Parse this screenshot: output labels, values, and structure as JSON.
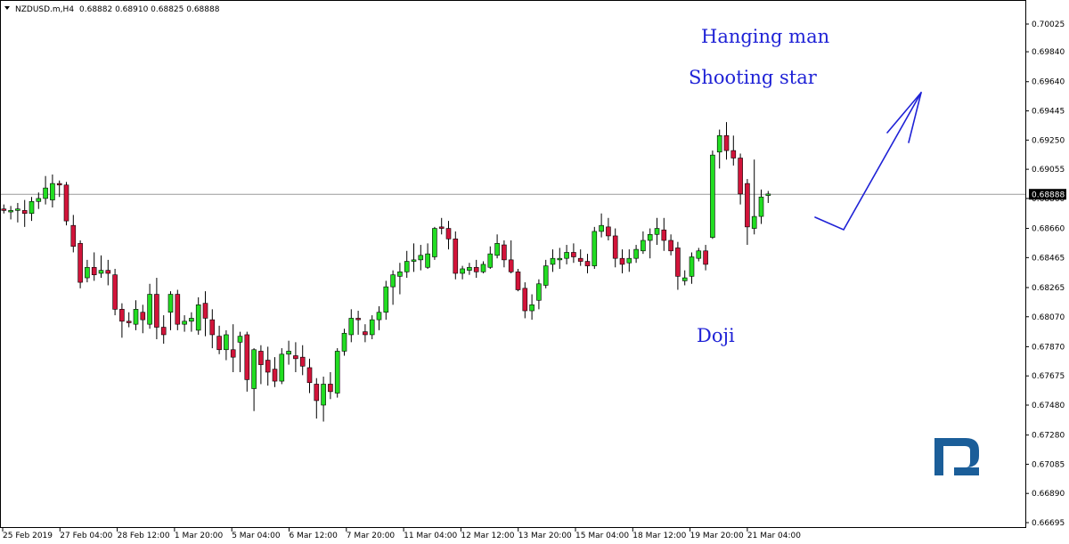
{
  "header": {
    "symbol": "NZDUSD.m,H4",
    "ohlc": "0.68882 0.68910 0.68825 0.68888"
  },
  "current_price_label": "0.68888",
  "colors": {
    "bull": "#22dd22",
    "bear": "#d2143a",
    "wick": "#000000",
    "annotation": "#1f22d6",
    "logo": "#1b5e99"
  },
  "annotations": [
    "Hanging man",
    "Shooting star",
    "Doji"
  ],
  "chart_data": {
    "type": "candlestick",
    "title": "",
    "ylim": [
      0.66695,
      0.70025
    ],
    "y_ticks": [
      0.70025,
      0.6984,
      0.6964,
      0.69445,
      0.6925,
      0.69055,
      0.6886,
      0.6866,
      0.68465,
      0.68265,
      0.6807,
      0.6787,
      0.67675,
      0.6748,
      0.6728,
      0.67085,
      0.6689,
      0.66695
    ],
    "y_tick_labels": [
      "0.70025",
      "0.69840",
      "0.69640",
      "0.69445",
      "0.69250",
      "0.69055",
      "0.68860",
      "0.68660",
      "0.68465",
      "0.68265",
      "0.68070",
      "0.67870",
      "0.67675",
      "0.67480",
      "0.67280",
      "0.67085",
      "0.66890",
      "0.66695"
    ],
    "x_tick_labels": [
      "25 Feb 2019",
      "27 Feb 04:00",
      "28 Feb 12:00",
      "1 Mar 20:00",
      "5 Mar 04:00",
      "6 Mar 12:00",
      "7 Mar 20:00",
      "11 Mar 04:00",
      "12 Mar 12:00",
      "13 Mar 20:00",
      "15 Mar 04:00",
      "18 Mar 12:00",
      "19 Mar 20:00",
      "21 Mar 04:00"
    ],
    "current_price": 0.68888,
    "candles": [
      [
        0.6879,
        0.6882,
        0.6876,
        0.6878
      ],
      [
        0.6877,
        0.6881,
        0.6872,
        0.6878
      ],
      [
        0.6878,
        0.6883,
        0.687,
        0.6879
      ],
      [
        0.6878,
        0.6885,
        0.6867,
        0.6876
      ],
      [
        0.6876,
        0.6887,
        0.6871,
        0.6884
      ],
      [
        0.6884,
        0.689,
        0.6879,
        0.6886
      ],
      [
        0.6886,
        0.6901,
        0.6882,
        0.6893
      ],
      [
        0.6885,
        0.6902,
        0.688,
        0.6896
      ],
      [
        0.6896,
        0.6898,
        0.6887,
        0.6895
      ],
      [
        0.6895,
        0.6897,
        0.6868,
        0.6871
      ],
      [
        0.6868,
        0.6875,
        0.685,
        0.6854
      ],
      [
        0.6856,
        0.6858,
        0.6826,
        0.683
      ],
      [
        0.6833,
        0.6845,
        0.683,
        0.684
      ],
      [
        0.684,
        0.685,
        0.6831,
        0.6835
      ],
      [
        0.6836,
        0.6848,
        0.6833,
        0.6838
      ],
      [
        0.6838,
        0.6845,
        0.6828,
        0.6836
      ],
      [
        0.6835,
        0.6839,
        0.6808,
        0.6812
      ],
      [
        0.6812,
        0.6816,
        0.6793,
        0.6804
      ],
      [
        0.6804,
        0.681,
        0.68,
        0.6803
      ],
      [
        0.6802,
        0.6818,
        0.6798,
        0.6812
      ],
      [
        0.681,
        0.6815,
        0.6796,
        0.6805
      ],
      [
        0.6802,
        0.6829,
        0.6799,
        0.6822
      ],
      [
        0.6822,
        0.6833,
        0.6792,
        0.68
      ],
      [
        0.68,
        0.6808,
        0.6789,
        0.6795
      ],
      [
        0.681,
        0.6824,
        0.6798,
        0.6822
      ],
      [
        0.6822,
        0.6825,
        0.6798,
        0.6802
      ],
      [
        0.6802,
        0.6808,
        0.6797,
        0.6804
      ],
      [
        0.6804,
        0.681,
        0.6797,
        0.6806
      ],
      [
        0.6798,
        0.682,
        0.6795,
        0.6815
      ],
      [
        0.6816,
        0.6824,
        0.6794,
        0.6806
      ],
      [
        0.6805,
        0.6812,
        0.6786,
        0.6795
      ],
      [
        0.6794,
        0.6801,
        0.6782,
        0.6785
      ],
      [
        0.6785,
        0.6798,
        0.6778,
        0.6795
      ],
      [
        0.6785,
        0.6802,
        0.677,
        0.678
      ],
      [
        0.679,
        0.6797,
        0.677,
        0.6794
      ],
      [
        0.6795,
        0.6797,
        0.6757,
        0.6765
      ],
      [
        0.6759,
        0.6786,
        0.6744,
        0.6785
      ],
      [
        0.6784,
        0.6788,
        0.6762,
        0.6775
      ],
      [
        0.6778,
        0.6787,
        0.6761,
        0.677
      ],
      [
        0.6772,
        0.678,
        0.676,
        0.6764
      ],
      [
        0.6764,
        0.6786,
        0.6762,
        0.6782
      ],
      [
        0.6782,
        0.6791,
        0.6775,
        0.6784
      ],
      [
        0.6781,
        0.679,
        0.677,
        0.6779
      ],
      [
        0.678,
        0.6788,
        0.6768,
        0.6774
      ],
      [
        0.6773,
        0.6779,
        0.6756,
        0.6763
      ],
      [
        0.6762,
        0.6766,
        0.6739,
        0.6751
      ],
      [
        0.6748,
        0.6767,
        0.6737,
        0.6762
      ],
      [
        0.6762,
        0.677,
        0.6752,
        0.6757
      ],
      [
        0.6756,
        0.6786,
        0.6753,
        0.6784
      ],
      [
        0.6784,
        0.6799,
        0.6781,
        0.6796
      ],
      [
        0.6795,
        0.6812,
        0.679,
        0.6806
      ],
      [
        0.6806,
        0.6811,
        0.6795,
        0.6805
      ],
      [
        0.6797,
        0.6802,
        0.679,
        0.6795
      ],
      [
        0.6795,
        0.6808,
        0.6792,
        0.6805
      ],
      [
        0.6805,
        0.6814,
        0.6798,
        0.681
      ],
      [
        0.681,
        0.6831,
        0.6805,
        0.6827
      ],
      [
        0.6827,
        0.6838,
        0.6815,
        0.6835
      ],
      [
        0.6834,
        0.6843,
        0.6822,
        0.6837
      ],
      [
        0.6837,
        0.6851,
        0.6833,
        0.6844
      ],
      [
        0.6844,
        0.6856,
        0.6837,
        0.6845
      ],
      [
        0.6845,
        0.6855,
        0.6838,
        0.6848
      ],
      [
        0.684,
        0.6856,
        0.6839,
        0.6849
      ],
      [
        0.6847,
        0.6867,
        0.6845,
        0.6866
      ],
      [
        0.6867,
        0.6873,
        0.6862,
        0.6866
      ],
      [
        0.6866,
        0.6871,
        0.6852,
        0.6859
      ],
      [
        0.6859,
        0.6864,
        0.6832,
        0.6836
      ],
      [
        0.6836,
        0.6841,
        0.6832,
        0.6839
      ],
      [
        0.6838,
        0.6843,
        0.6835,
        0.684
      ],
      [
        0.684,
        0.6845,
        0.6833,
        0.6837
      ],
      [
        0.6837,
        0.6844,
        0.6836,
        0.6842
      ],
      [
        0.684,
        0.6854,
        0.6839,
        0.6849
      ],
      [
        0.6848,
        0.6862,
        0.6846,
        0.6856
      ],
      [
        0.6855,
        0.6858,
        0.684,
        0.6845
      ],
      [
        0.6845,
        0.6858,
        0.6836,
        0.6837
      ],
      [
        0.6837,
        0.6839,
        0.6824,
        0.6825
      ],
      [
        0.6826,
        0.683,
        0.6806,
        0.6811
      ],
      [
        0.6811,
        0.6822,
        0.6805,
        0.6815
      ],
      [
        0.6818,
        0.6832,
        0.6812,
        0.6829
      ],
      [
        0.6828,
        0.6845,
        0.6826,
        0.6841
      ],
      [
        0.6842,
        0.6852,
        0.6837,
        0.6846
      ],
      [
        0.6845,
        0.6853,
        0.6839,
        0.6846
      ],
      [
        0.6846,
        0.6855,
        0.6842,
        0.685
      ],
      [
        0.685,
        0.6856,
        0.6843,
        0.6847
      ],
      [
        0.6846,
        0.6852,
        0.6841,
        0.6844
      ],
      [
        0.6844,
        0.6849,
        0.6836,
        0.6841
      ],
      [
        0.6841,
        0.6867,
        0.6839,
        0.6864
      ],
      [
        0.6864,
        0.6876,
        0.686,
        0.6868
      ],
      [
        0.6867,
        0.6873,
        0.6858,
        0.6861
      ],
      [
        0.6861,
        0.6866,
        0.684,
        0.6846
      ],
      [
        0.6846,
        0.6852,
        0.6836,
        0.6842
      ],
      [
        0.6843,
        0.6852,
        0.6837,
        0.6846
      ],
      [
        0.6846,
        0.6855,
        0.6843,
        0.6852
      ],
      [
        0.6851,
        0.6864,
        0.6849,
        0.6858
      ],
      [
        0.6858,
        0.6866,
        0.6846,
        0.6862
      ],
      [
        0.6862,
        0.6873,
        0.6855,
        0.6866
      ],
      [
        0.6865,
        0.6873,
        0.6851,
        0.6858
      ],
      [
        0.6858,
        0.6862,
        0.6848,
        0.6851
      ],
      [
        0.6853,
        0.6857,
        0.6825,
        0.6834
      ],
      [
        0.6831,
        0.6838,
        0.6828,
        0.6833
      ],
      [
        0.6834,
        0.685,
        0.6829,
        0.6847
      ],
      [
        0.6846,
        0.6853,
        0.6844,
        0.6851
      ],
      [
        0.6851,
        0.6855,
        0.6838,
        0.6842
      ],
      [
        0.686,
        0.6918,
        0.6859,
        0.6915
      ],
      [
        0.6917,
        0.6932,
        0.6906,
        0.6928
      ],
      [
        0.6928,
        0.6937,
        0.6912,
        0.6918
      ],
      [
        0.6918,
        0.6928,
        0.6908,
        0.6913
      ],
      [
        0.6913,
        0.6916,
        0.6882,
        0.6889
      ],
      [
        0.6896,
        0.6899,
        0.6855,
        0.6867
      ],
      [
        0.6866,
        0.6912,
        0.6862,
        0.6874
      ],
      [
        0.6874,
        0.6892,
        0.6869,
        0.6887
      ],
      [
        0.6888,
        0.6891,
        0.6883,
        0.6889
      ]
    ]
  }
}
